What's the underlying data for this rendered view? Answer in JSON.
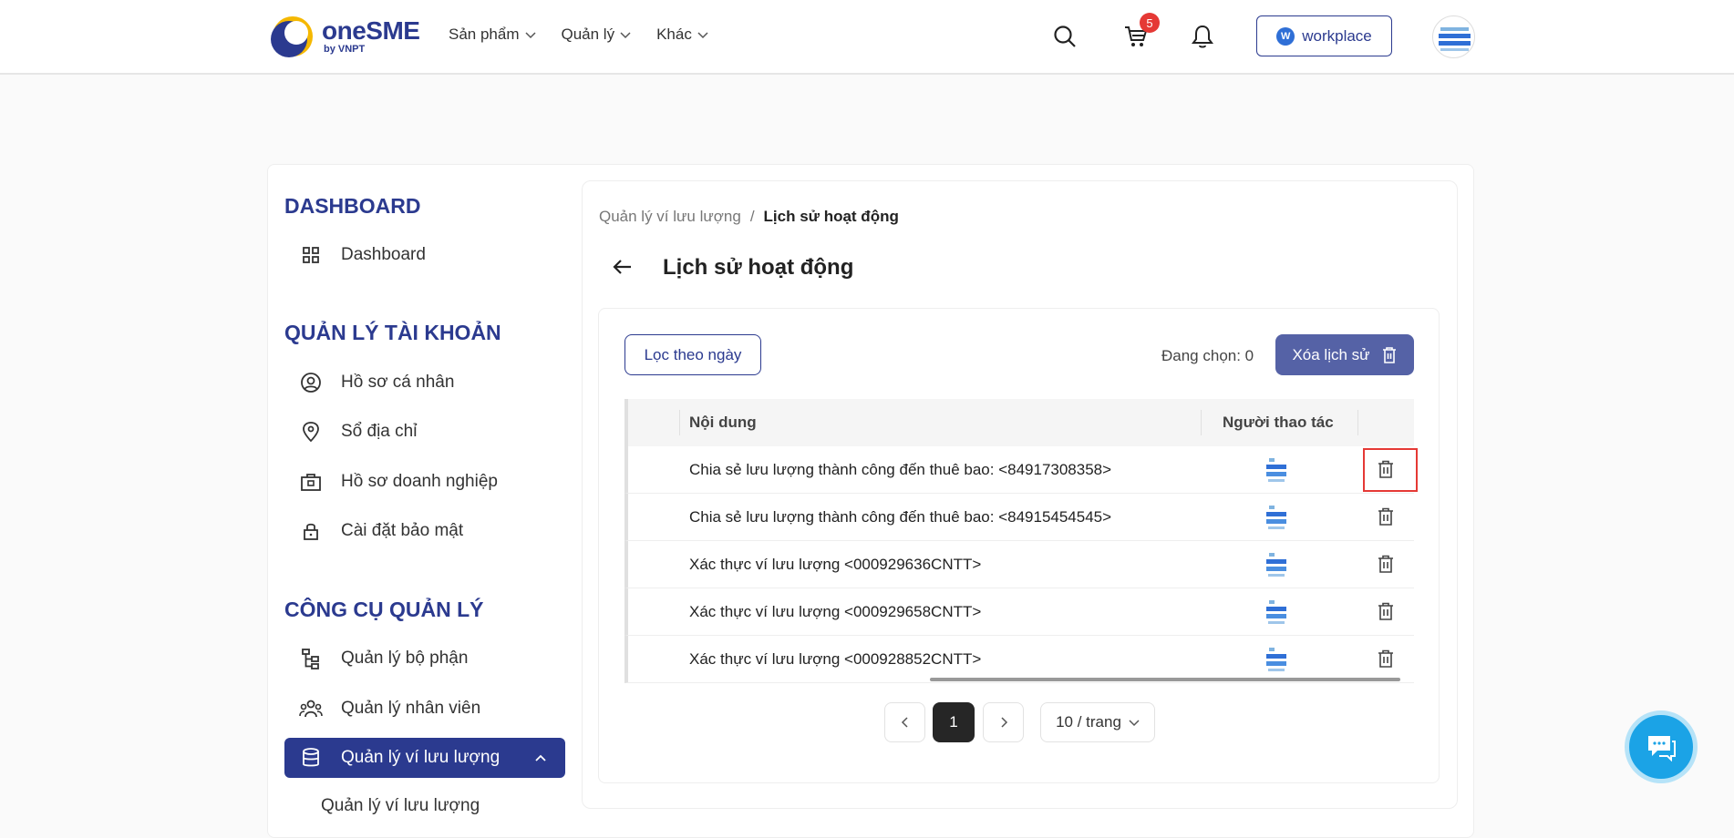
{
  "header": {
    "logo": {
      "title": "oneSME",
      "subtitle": "by VNPT"
    },
    "nav": [
      {
        "label": "Sản phẩm"
      },
      {
        "label": "Quản lý"
      },
      {
        "label": "Khác"
      }
    ],
    "cart_count": "5",
    "workplace_label": "workplace",
    "icons": [
      "search-icon",
      "cart-icon",
      "bell-icon"
    ]
  },
  "sidebar": {
    "sections": [
      {
        "heading": "DASHBOARD",
        "items": [
          {
            "label": "Dashboard",
            "icon": "grid-icon"
          }
        ]
      },
      {
        "heading": "QUẢN LÝ TÀI KHOẢN",
        "items": [
          {
            "label": "Hồ sơ cá nhân",
            "icon": "user-circle-icon"
          },
          {
            "label": "Sổ địa chỉ",
            "icon": "location-pin-icon"
          },
          {
            "label": "Hồ sơ doanh nghiệp",
            "icon": "briefcase-icon"
          },
          {
            "label": "Cài đặt bảo mật",
            "icon": "lock-icon"
          }
        ]
      },
      {
        "heading": "CÔNG CỤ QUẢN LÝ",
        "items": [
          {
            "label": "Quản lý bộ phận",
            "icon": "org-tree-icon"
          },
          {
            "label": "Quản lý nhân viên",
            "icon": "users-icon"
          },
          {
            "label": "Quản lý ví lưu lượng",
            "icon": "database-icon",
            "active": true
          }
        ]
      }
    ],
    "sub_item": "Quản lý ví lưu lượng"
  },
  "main": {
    "breadcrumb": {
      "parent": "Quản lý ví lưu lượng",
      "separator": "/",
      "current": "Lịch sử hoạt động"
    },
    "title": "Lịch sử hoạt động",
    "filter_button": "Lọc theo ngày",
    "selected_count": "Đang chọn: 0",
    "delete_history_button": "Xóa lịch sử",
    "table": {
      "columns": [
        "Nội dung",
        "Người thao tác"
      ],
      "rows": [
        {
          "content": "Chia sẻ lưu lượng thành công đến thuê bao: <84917308358>"
        },
        {
          "content": "Chia sẻ lưu lượng thành công đến thuê bao: <84915454545>"
        },
        {
          "content": "Xác thực ví lưu lượng <000929636CNTT>"
        },
        {
          "content": "Xác thực ví lưu lượng <000929658CNTT>"
        },
        {
          "content": "Xác thực ví lưu lượng <000928852CNTT>"
        }
      ]
    },
    "pagination": {
      "current_page": "1",
      "page_size": "10 / trang"
    }
  },
  "colors": {
    "brand": "#2b3a8f",
    "button_fill": "#5562a6",
    "badge": "#e53935",
    "chat": "#1ba3e6",
    "highlight": "#e53935"
  }
}
